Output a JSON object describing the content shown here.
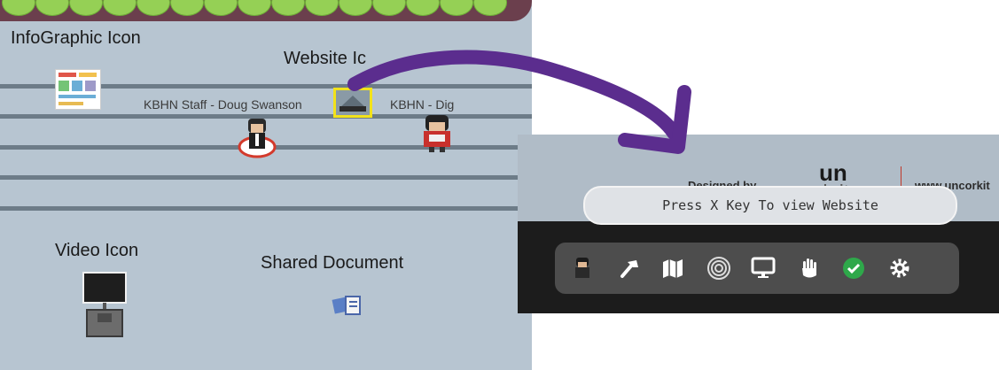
{
  "game": {
    "infographic_label": "InfoGraphic Icon",
    "website_label": "Website Ic",
    "staff_label": "KBHN Staff - Doug Swanson",
    "dig_label": "KBHN - Dig",
    "video_label": "Video Icon",
    "shared_doc_label": "Shared Document"
  },
  "popup": {
    "designed_by": "Designed by",
    "logo_top": "un",
    "logo_bottom": "cork-it",
    "site_url": "www.uncorkit",
    "hint": "Press X Key To view Website"
  },
  "toolbar": {
    "items": [
      "avatar",
      "hammer-icon",
      "map-icon",
      "portal-icon",
      "monitor-icon",
      "hand-icon",
      "check-icon",
      "gear-icon"
    ]
  },
  "colors": {
    "arrow": "#5b2d8e",
    "check": "#2ea84a",
    "awning": "#6b3f4d",
    "scallop": "#95d055"
  }
}
